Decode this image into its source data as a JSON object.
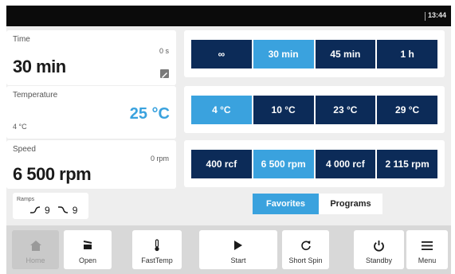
{
  "status": {
    "clock": "13:44"
  },
  "time_card": {
    "label": "Time",
    "value": "30 min",
    "remaining": "0 s"
  },
  "temp_card": {
    "label": "Temperature",
    "setpoint": "25 °C",
    "actual": "4 °C"
  },
  "speed_card": {
    "label": "Speed",
    "value": "6 500 rpm",
    "actual": "0 rpm"
  },
  "time_options": [
    {
      "label": "∞",
      "active": false
    },
    {
      "label": "30 min",
      "active": true
    },
    {
      "label": "45 min",
      "active": false
    },
    {
      "label": "1 h",
      "active": false
    }
  ],
  "temp_options": [
    {
      "label": "4 °C",
      "active": true
    },
    {
      "label": "10 °C",
      "active": false
    },
    {
      "label": "23 °C",
      "active": false
    },
    {
      "label": "29 °C",
      "active": false
    }
  ],
  "speed_options": [
    {
      "label": "400 rcf",
      "active": false
    },
    {
      "label": "6 500 rpm",
      "active": true
    },
    {
      "label": "4 000 rcf",
      "active": false
    },
    {
      "label": "2 115 rpm",
      "active": false
    }
  ],
  "ramps": {
    "label": "Ramps",
    "up": "9",
    "down": "9"
  },
  "tabs": {
    "favorites": "Favorites",
    "programs": "Programs"
  },
  "nav": {
    "home": "Home",
    "open": "Open",
    "fasttemp": "FastTemp",
    "start": "Start",
    "short_spin": "Short Spin",
    "standby": "Standby",
    "menu": "Menu"
  },
  "colors": {
    "accent": "#3aa2de",
    "navy": "#0c2b58",
    "statusbar": "#0b0b0b"
  }
}
